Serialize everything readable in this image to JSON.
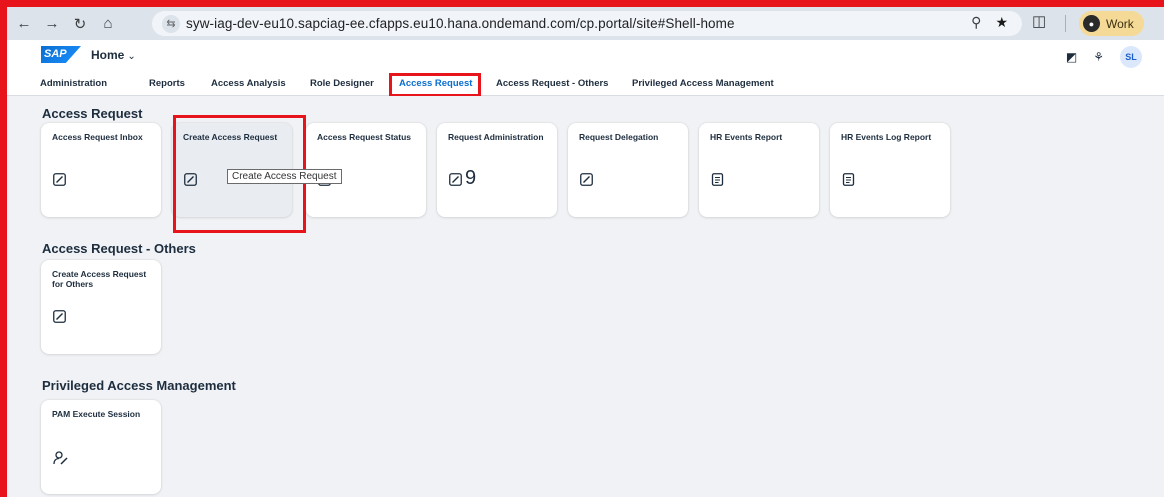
{
  "browser": {
    "url_text": "syw-iag-dev-eu10.sapciag-ee.cfapps.eu10.hana.ondemand.com/cp.portal/site#Shell-home",
    "profile_label": "Work",
    "icons": [
      "back-icon",
      "forward-icon",
      "reload-icon",
      "home-icon",
      "site-info-icon",
      "zoom-icon",
      "bookmark-star-icon",
      "extensions-icon",
      "menu-icon"
    ]
  },
  "shell": {
    "logo_text": "SAP",
    "home_label": "Home",
    "avatar_initials": "SL"
  },
  "tabs": [
    {
      "label": "Administration"
    },
    {
      "label": "Reports"
    },
    {
      "label": "Access Analysis"
    },
    {
      "label": "Role Designer"
    },
    {
      "label": "Access Request"
    },
    {
      "label": "Access Request - Others"
    },
    {
      "label": "Privileged Access Management"
    }
  ],
  "active_tab": "Access Request",
  "sections": [
    {
      "title": "Access Request",
      "tiles": [
        {
          "title": "Access Request Inbox",
          "icon": "edit-icon"
        },
        {
          "title": "Create Access Request",
          "icon": "edit-icon"
        },
        {
          "title": "Access Request Status",
          "icon": "edit-icon"
        },
        {
          "title": "Request Administration",
          "icon": "edit-icon",
          "count": "9"
        },
        {
          "title": "Request Delegation",
          "icon": "edit-icon"
        },
        {
          "title": "HR Events Report",
          "icon": "checklist-icon"
        },
        {
          "title": "HR Events Log Report",
          "icon": "checklist-icon"
        }
      ]
    },
    {
      "title": "Access Request - Others",
      "tiles": [
        {
          "title": "Create Access Request for Others",
          "icon": "edit-icon"
        }
      ]
    },
    {
      "title": "Privileged Access Management",
      "tiles": [
        {
          "title": "PAM Execute Session",
          "icon": "user-edit-icon"
        }
      ]
    }
  ],
  "tooltip_text": "Create Access Request",
  "colors": {
    "annotation_red": "#e8141b",
    "sap_blue": "#0a6ed1",
    "text_dark": "#1d2d3e",
    "canvas": "#f0f2f5",
    "profile_badge": "#f5d996"
  }
}
